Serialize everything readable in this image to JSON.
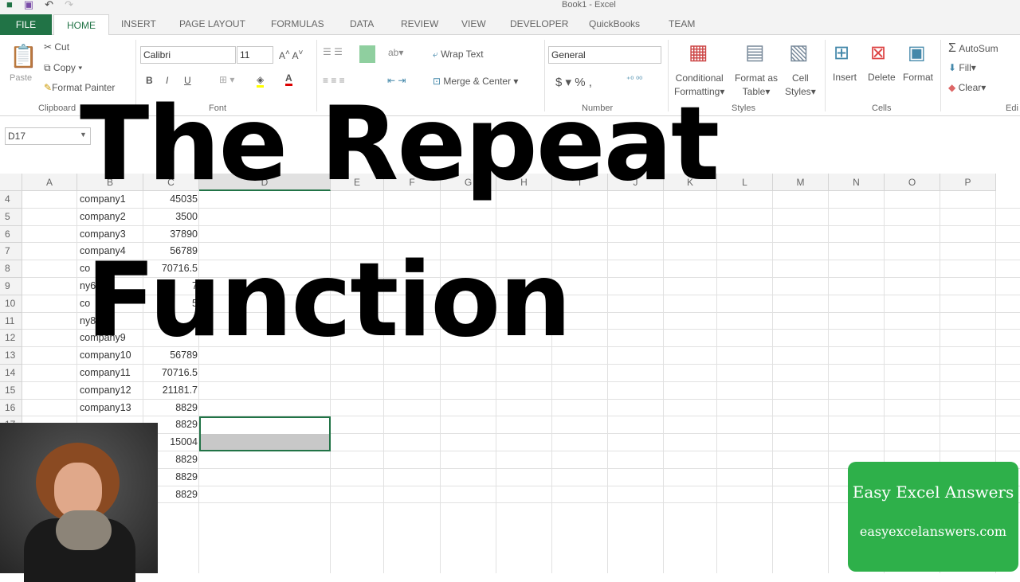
{
  "window": {
    "title": "Book1 - Excel"
  },
  "tabs": [
    "FILE",
    "HOME",
    "INSERT",
    "PAGE LAYOUT",
    "FORMULAS",
    "DATA",
    "REVIEW",
    "VIEW",
    "DEVELOPER",
    "QuickBooks",
    "TEAM"
  ],
  "ribbon": {
    "clipboard": {
      "paste": "Paste",
      "cut": "Cut",
      "copy": "Copy",
      "format_painter": "Format Painter",
      "label": "Clipboard"
    },
    "font": {
      "name": "Calibri",
      "size": "11",
      "bold": "B",
      "italic": "I",
      "underline": "U",
      "label": "Font"
    },
    "alignment": {
      "wrap": "Wrap Text",
      "merge": "Merge & Center"
    },
    "number": {
      "format": "General",
      "currency": "$",
      "percent": "%",
      "comma": ",",
      "label": "Number"
    },
    "styles": {
      "conditional": "Conditional",
      "conditional2": "Formatting",
      "format_table": "Format as",
      "format_table2": "Table",
      "cell_styles": "Cell",
      "cell_styles2": "Styles",
      "label": "Styles"
    },
    "cells": {
      "insert": "Insert",
      "delete": "Delete",
      "format": "Format",
      "label": "Cells"
    },
    "editing": {
      "autosum": "AutoSum",
      "fill": "Fill",
      "clear": "Clear",
      "label": "Edi"
    }
  },
  "name_box": "D17",
  "columns": [
    "A",
    "B",
    "C",
    "D",
    "E",
    "F",
    "G",
    "H",
    "I",
    "J",
    "K",
    "L",
    "M",
    "N",
    "O",
    "P"
  ],
  "rows": [
    {
      "n": "4",
      "b": "company1",
      "c": "45035"
    },
    {
      "n": "5",
      "b": "company2",
      "c": "3500"
    },
    {
      "n": "6",
      "b": "company3",
      "c": "37890"
    },
    {
      "n": "7",
      "b": "company4",
      "c": "56789"
    },
    {
      "n": "8",
      "b": "co",
      "c": "70716.5"
    },
    {
      "n": "9",
      "b": "ny6",
      "c": "7"
    },
    {
      "n": "10",
      "b": "co",
      "c": "5"
    },
    {
      "n": "11",
      "b": "ny8",
      "c": "0"
    },
    {
      "n": "12",
      "b": "company9",
      "c": ""
    },
    {
      "n": "13",
      "b": "company10",
      "c": "56789"
    },
    {
      "n": "14",
      "b": "company11",
      "c": "70716.5"
    },
    {
      "n": "15",
      "b": "company12",
      "c": "21181.7"
    },
    {
      "n": "16",
      "b": "company13",
      "c": "8829"
    },
    {
      "n": "17",
      "b": "",
      "c": "8829"
    },
    {
      "n": "18",
      "b": "",
      "c": "15004"
    },
    {
      "n": "19",
      "b": "",
      "c": "8829"
    },
    {
      "n": "20",
      "b": "",
      "c": "8829"
    },
    {
      "n": "21",
      "b": "",
      "c": "8829"
    }
  ],
  "overlay": {
    "line1": "The Repeat",
    "line2": "Function"
  },
  "badge": {
    "title": "Easy Excel Answers",
    "url": "easyexcelanswers.com",
    "color": "#2eb04a"
  },
  "accent": "#217346"
}
